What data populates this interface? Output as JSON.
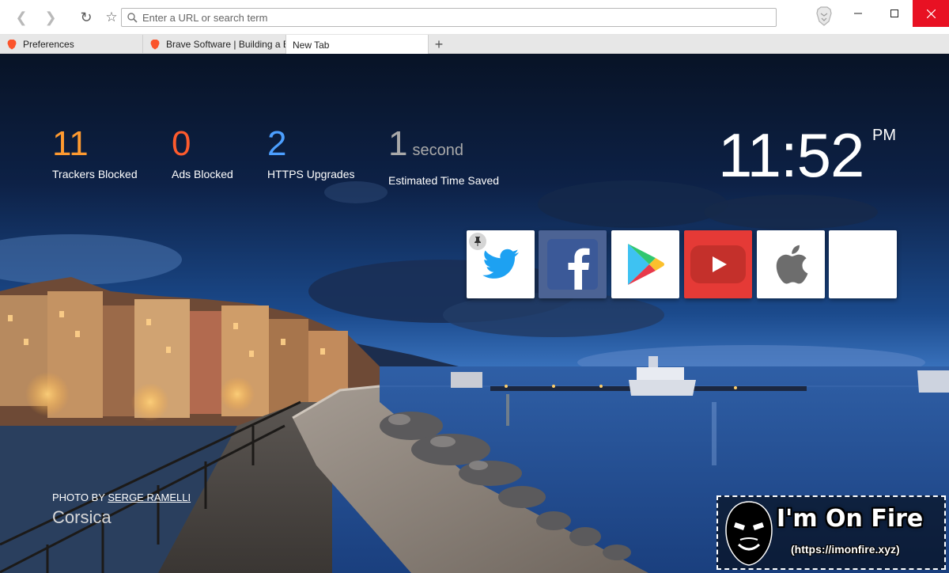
{
  "toolbar": {
    "url_placeholder": "Enter a URL or search term"
  },
  "tabs": [
    {
      "label": "Preferences"
    },
    {
      "label": "Brave Software | Building a Better Web"
    },
    {
      "label": "New Tab"
    }
  ],
  "stats": {
    "trackers": {
      "value": "11",
      "label": "Trackers Blocked",
      "color": "#fe9a30"
    },
    "ads": {
      "value": "0",
      "label": "Ads Blocked",
      "color": "#fe5b2d"
    },
    "https": {
      "value": "2",
      "label": "HTTPS Upgrades",
      "color": "#4c9fff"
    },
    "time": {
      "value": "1",
      "unit": "second",
      "label": "Estimated Time Saved",
      "color": "#a9a9a9"
    }
  },
  "clock": {
    "time": "11:52",
    "ampm": "PM"
  },
  "top_sites": [
    {
      "icon": "twitter-icon",
      "pinned": true
    },
    {
      "icon": "facebook-icon"
    },
    {
      "icon": "google-play-icon"
    },
    {
      "icon": "youtube-icon"
    },
    {
      "icon": "apple-icon"
    },
    {
      "icon": "empty"
    }
  ],
  "photo": {
    "credit_prefix": "PHOTO BY",
    "credit_author": "SERGE RAMELLI",
    "location": "Corsica"
  },
  "watermark": {
    "title": "I'm On Fire",
    "url": "(https://imonfire.xyz)"
  },
  "colors": {
    "close_button": "#e81123",
    "facebook_tile": "#4c6394",
    "youtube_tile": "#e53a36",
    "brave_orange": "#fb542b"
  }
}
